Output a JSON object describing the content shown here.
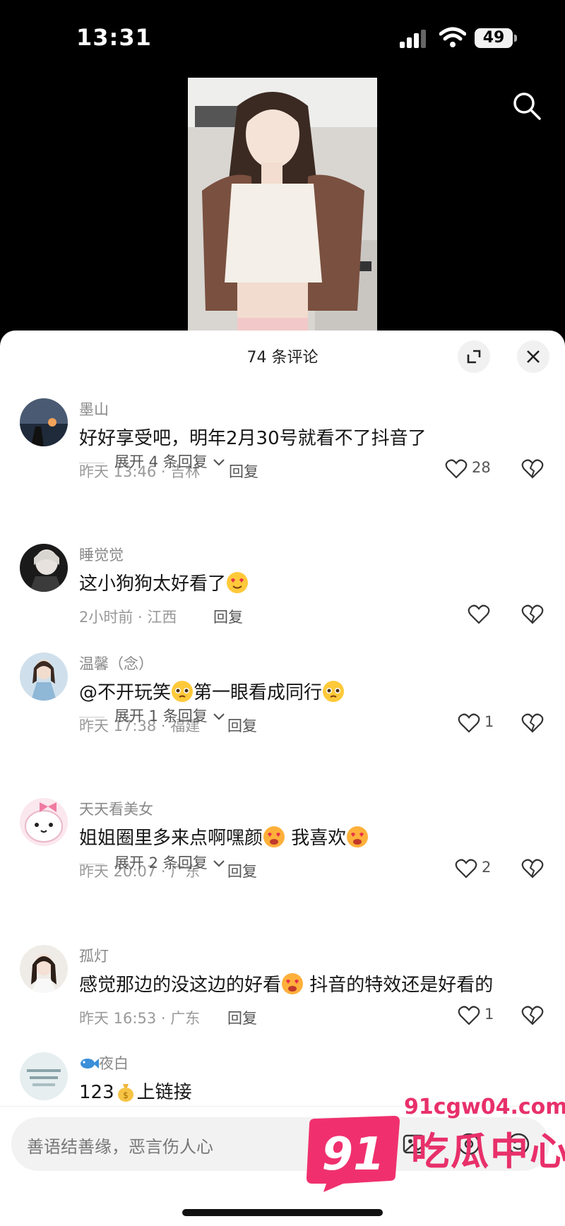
{
  "status_bar": {
    "time": "13:31",
    "battery": "49"
  },
  "panel": {
    "title": "74 条评论"
  },
  "comments": [
    {
      "user": "墨山",
      "text": "好好享受吧，明年2月30号就看不了抖音了",
      "meta": "昨天 13:46 · 吉林",
      "reply": "回复",
      "likes": "28",
      "expand": "展开 4 条回复"
    },
    {
      "user": "睡觉觉",
      "text": "这小狗狗太好看了",
      "meta": "2小时前 · 江西",
      "reply": "回复",
      "likes": ""
    },
    {
      "user": "温馨（念）",
      "text_parts": [
        "@不开玩笑",
        "第一眼看成同行"
      ],
      "meta": "昨天 17:38 · 福建",
      "reply": "回复",
      "likes": "1",
      "expand": "展开 1 条回复"
    },
    {
      "user": "天天看美女",
      "text_parts": [
        "姐姐圈里多来点啊嘿颜",
        " 我喜欢"
      ],
      "meta": "昨天 20:07 · 广东",
      "reply": "回复",
      "likes": "2",
      "expand": "展开 2 条回复"
    },
    {
      "user": "孤灯",
      "text_parts": [
        "感觉那边的没这边的好看",
        " 抖音的特效还是好看的"
      ],
      "meta": "昨天 16:53 · 广东",
      "reply": "回复",
      "likes": "1"
    },
    {
      "user": "夜白",
      "text_parts": [
        "123",
        "上链接"
      ]
    }
  ],
  "input": {
    "placeholder": "善语结善缘，恶言伤人心"
  },
  "watermark": {
    "badge": "91",
    "url": "91cgw04.com",
    "name": "吃瓜中心"
  },
  "icons": [
    "search-icon",
    "expand-icon",
    "close-icon",
    "heart-icon",
    "broken-heart-icon",
    "chevron-down-icon",
    "image-icon",
    "at-icon",
    "smile-icon"
  ],
  "colors": {
    "brand": "#e8306a",
    "panel_bg": "#ffffff",
    "text": "#161616",
    "meta": "#999999"
  }
}
